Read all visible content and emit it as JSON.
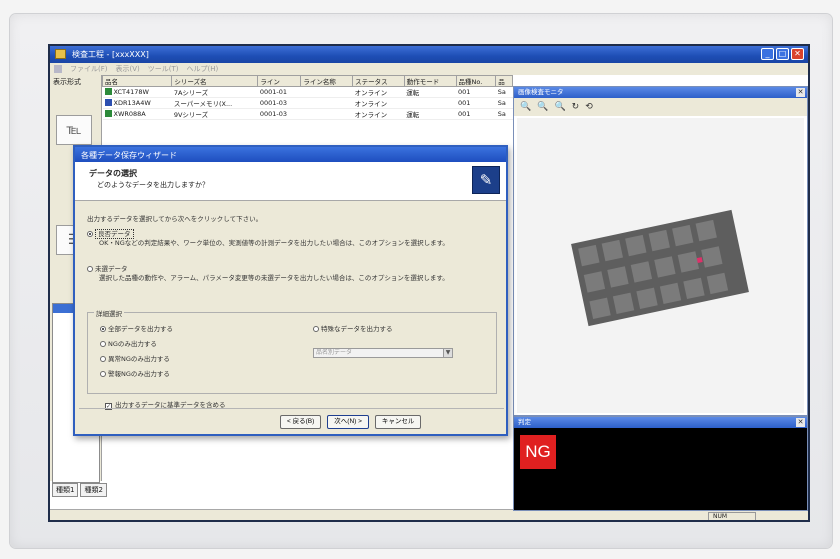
{
  "corner_caption": "",
  "window": {
    "title": "検査工程 - [xxxXXX]",
    "menu": [
      "ファイル(F)",
      "表示(V)",
      "ツール(T)",
      "ヘルプ(H)"
    ]
  },
  "left_panel": {
    "tab_label": "表示形式"
  },
  "table": {
    "columns": [
      "品名",
      "シリーズ名",
      "ライン",
      "ライン名称",
      "ステータス",
      "動作モード",
      "品種No.",
      "品"
    ],
    "rows": [
      {
        "color": "#2c8a3a",
        "cells": [
          "XCT4178W",
          "7Aシリーズ",
          "0001-01",
          "",
          "オンライン",
          "運転",
          "001",
          "Sa"
        ]
      },
      {
        "color": "#2c4fb0",
        "cells": [
          "XDR13A4W",
          "スーパーメモリ(X...",
          "0001-03",
          "",
          "オンライン",
          "",
          "001",
          "Sa"
        ]
      },
      {
        "color": "#2c8a3a",
        "cells": [
          "XWR088A",
          "9Vシリーズ",
          "0001-03",
          "",
          "オンライン",
          "運転",
          "001",
          "Sa"
        ]
      }
    ]
  },
  "bottom_tabs": [
    "種類1",
    "種類2"
  ],
  "status": {
    "cell": "NUM"
  },
  "monitor": {
    "title": "画像検査モニタ"
  },
  "result": {
    "title": "判定",
    "badge": "NG"
  },
  "dialog": {
    "title": "各種データ保存ウィザード",
    "header_title": "データの選択",
    "header_subtitle": "どのようなデータを出力しますか？",
    "intro": "出力するデータを選択してから次へをクリックして下さい。",
    "option1_label": "良否データ",
    "option1_desc": "OK・NGなどの判定結果や、ワーク単位の、実測値等の計測データを出力したい場合は、このオプションを選択します。",
    "option2_label": "未選データ",
    "option2_desc": "選択した品種の動作や、アラーム、パラメータ変更等の未選データを出力したい場合は、このオプションを選択します。",
    "group_label": "詳細選択",
    "detail_options": [
      "全部データを出力する",
      "NGのみ出力する",
      "異常NGのみ出力する",
      "警報NGのみ出力する"
    ],
    "specific_option": "特殊なデータを出力する",
    "combo_value": "品名別データ",
    "checkbox_label": "出力するデータに基準データを含める",
    "buttons": {
      "back": "< 戻る(B)",
      "next": "次へ(N) >",
      "cancel": "キャンセル"
    }
  }
}
